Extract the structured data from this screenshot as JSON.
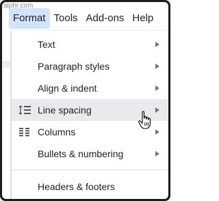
{
  "watermark": "alphr.com",
  "menubar": {
    "items": [
      "Format",
      "Tools",
      "Add-ons",
      "Help"
    ]
  },
  "menu": {
    "items": [
      {
        "label": "Text",
        "icon": "",
        "submenu": true
      },
      {
        "label": "Paragraph styles",
        "icon": "",
        "submenu": true
      },
      {
        "label": "Align & indent",
        "icon": "",
        "submenu": true
      },
      {
        "label": "Line spacing",
        "icon": "line-spacing-icon",
        "submenu": true,
        "hover": true
      },
      {
        "label": "Columns",
        "icon": "columns-icon",
        "submenu": true
      },
      {
        "label": "Bullets & numbering",
        "icon": "",
        "submenu": true
      },
      {
        "label": "Headers & footers",
        "icon": "",
        "submenu": false
      }
    ]
  },
  "colors": {
    "active_menu_bg": "#d2e3fc",
    "hover_item_bg": "#e8eaed",
    "text": "#202124",
    "arrow": "#757575",
    "frame": "#1b1b1b"
  }
}
